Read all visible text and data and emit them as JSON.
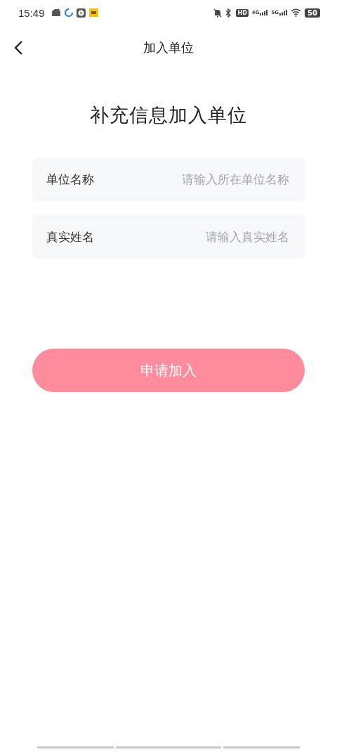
{
  "status_bar": {
    "time": "15:49",
    "network": [
      "4G",
      "5G"
    ],
    "hd": "HD",
    "battery": "50"
  },
  "header": {
    "title": "加入单位"
  },
  "heading": "补充信息加入单位",
  "fields": [
    {
      "label": "单位名称",
      "placeholder": "请输入所在单位名称"
    },
    {
      "label": "真实姓名",
      "placeholder": "请输入真实姓名"
    }
  ],
  "submit_button": {
    "label": "申请加入",
    "disabled": true
  }
}
